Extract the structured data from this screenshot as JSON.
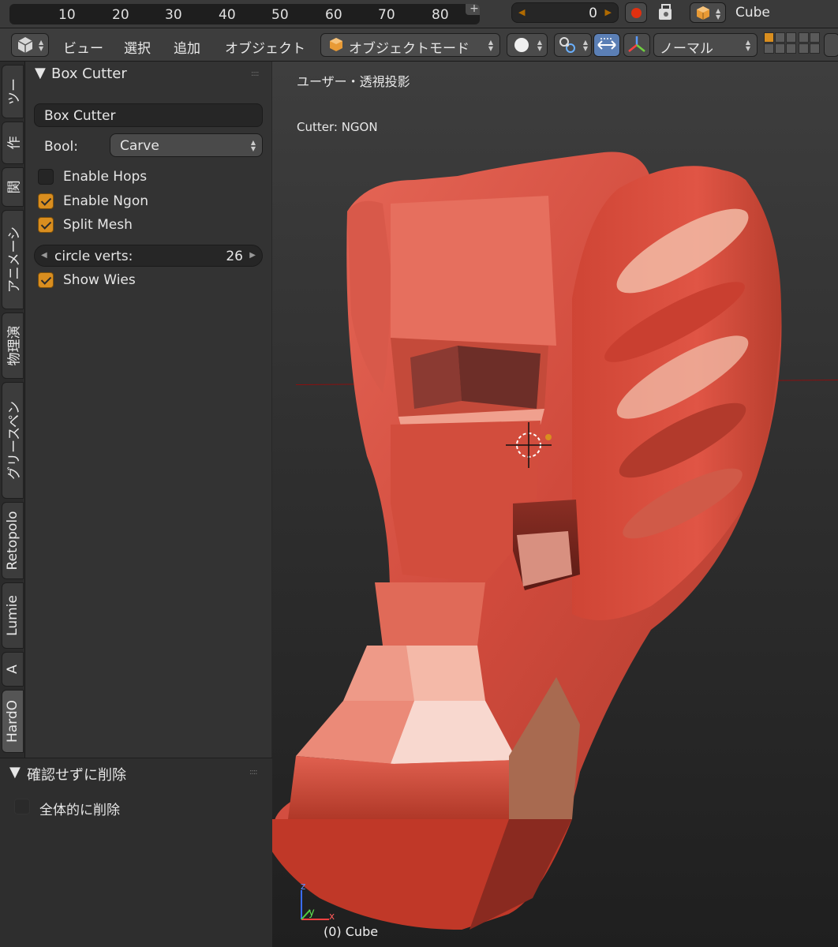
{
  "timeline": {
    "ticks": [
      "10",
      "20",
      "30",
      "40",
      "50",
      "60",
      "70",
      "80"
    ],
    "plus": "+",
    "current_frame": "0",
    "object_name": "Cube"
  },
  "header": {
    "menus": [
      "ビュー",
      "選択",
      "追加",
      "オブジェクト"
    ],
    "mode": "オブジェクトモード",
    "orientation": "ノーマル"
  },
  "tabs": [
    "ツー",
    "作",
    "関",
    "アニメーシ",
    "物理演",
    "グリースペン",
    "Retopolo",
    "Lumie",
    "A",
    "HardO"
  ],
  "tool_panel": {
    "title": "Box Cutter",
    "name_field": "Box Cutter",
    "bool_label": "Bool:",
    "bool_value": "Carve",
    "checkboxes": [
      {
        "label": "Enable Hops",
        "checked": false
      },
      {
        "label": "Enable Ngon",
        "checked": true
      },
      {
        "label": "Split Mesh",
        "checked": true
      }
    ],
    "circle_verts_label": "circle verts:",
    "circle_verts_value": "26",
    "show_wires": {
      "label": "Show Wies",
      "checked": true
    }
  },
  "operator_panel": {
    "title": "確認せずに削除",
    "option": {
      "label": "全体的に削除",
      "checked": false
    }
  },
  "viewport": {
    "title": "ユーザー・透視投影",
    "cutter_info": "Cutter: NGON",
    "object_label": "(0) Cube",
    "axes": {
      "z": "z",
      "y": "y",
      "x": "x"
    }
  },
  "colors": {
    "accent": "#d98e1f",
    "mesh": "#e06050",
    "record": "#e03010"
  }
}
